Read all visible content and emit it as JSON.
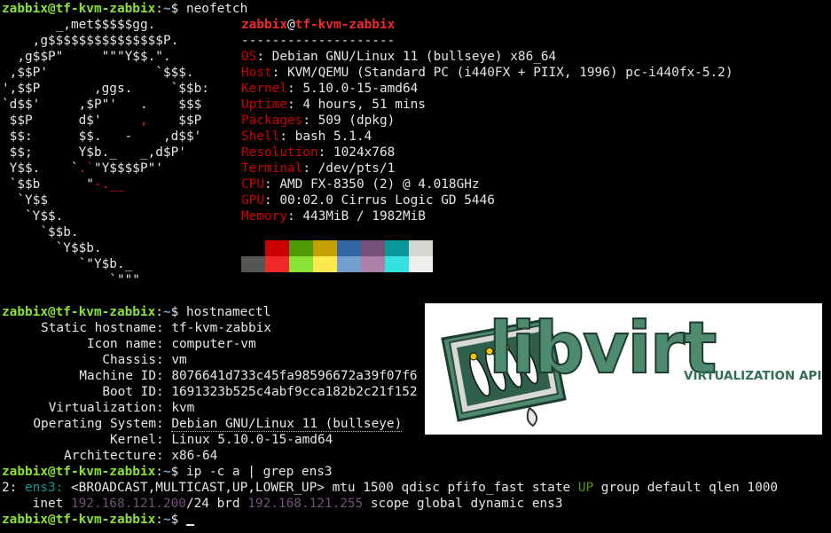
{
  "prompt": {
    "user_host": "zabbix@tf-kvm-zabbix",
    "sep": ":",
    "path": "~",
    "dollar": "$ "
  },
  "commands": {
    "neofetch": "neofetch",
    "hostnamectl": "hostnamectl",
    "ip": "ip -c a | grep ens3",
    "current": ""
  },
  "debian_logo_lines": [
    "       _,met$$$$$gg.",
    "    ,g$$$$$$$$$$$$$$$P.",
    "  ,g$$P\"     \"\"\"Y$$.\".",
    " ,$$P'              `$$$.",
    "',$$P       ,ggs.     `$$b:",
    "`d$$'     ,$P\"'   .    $$$",
    " $$P      d$'     ,    $$P",
    " $$:      $$.   -    ,d$$'",
    " $$;      Y$b._   _,d$P'",
    " Y$$.    `.`\"Y$$$$P\"'",
    " `$$b      \"-.__",
    "  `Y$$",
    "   `Y$$.",
    "     `$$b.",
    "       `Y$$b.",
    "          `\"Y$b._",
    "              `\"\"\""
  ],
  "neofetch": {
    "user": "zabbix",
    "at": "@",
    "host": "tf-kvm-zabbix",
    "divider": "--------------------",
    "rows": [
      {
        "key": "OS",
        "value": "Debian GNU/Linux 11 (bullseye) x86_64"
      },
      {
        "key": "Host",
        "value": "KVM/QEMU (Standard PC (i440FX + PIIX, 1996) pc-i440fx-5.2)"
      },
      {
        "key": "Kernel",
        "value": "5.10.0-15-amd64"
      },
      {
        "key": "Uptime",
        "value": "4 hours, 51 mins"
      },
      {
        "key": "Packages",
        "value": "509 (dpkg)"
      },
      {
        "key": "Shell",
        "value": "bash 5.1.4"
      },
      {
        "key": "Resolution",
        "value": "1024x768"
      },
      {
        "key": "Terminal",
        "value": "/dev/pts/1"
      },
      {
        "key": "CPU",
        "value": "AMD FX-8350 (2) @ 4.018GHz"
      },
      {
        "key": "GPU",
        "value": "00:02.0 Cirrus Logic GD 5446"
      },
      {
        "key": "Memory",
        "value": "443MiB / 1982MiB"
      }
    ],
    "palette_top": [
      "#000000",
      "#cc0000",
      "#4e9a06",
      "#c4a000",
      "#3465a4",
      "#75507b",
      "#06989a",
      "#d3d7cf"
    ],
    "palette_bottom": [
      "#555753",
      "#ef2929",
      "#8ae234",
      "#fce94f",
      "#729fcf",
      "#ad7fa8",
      "#34e2e2",
      "#eeeeec"
    ]
  },
  "hostnamectl": [
    {
      "key": "Static hostname",
      "value": "tf-kvm-zabbix"
    },
    {
      "key": "Icon name",
      "value": "computer-vm"
    },
    {
      "key": "Chassis",
      "value": "vm"
    },
    {
      "key": "Machine ID",
      "value": "8076641d733c45fa98596672a39f07f6"
    },
    {
      "key": "Boot ID",
      "value": "1691323b525c4abf9cca182b2c21f152"
    },
    {
      "key": "Virtualization",
      "value": "kvm"
    },
    {
      "key": "Operating System",
      "value": "Debian GNU/Linux 11 (bullseye)"
    },
    {
      "key": "Kernel",
      "value": "Linux 5.10.0-15-amd64"
    },
    {
      "key": "Architecture",
      "value": "x86-64"
    }
  ],
  "ip_output": {
    "idx": "2: ",
    "iface": "ens3:",
    "flags": " <BROADCAST,MULTICAST,UP,LOWER_UP> mtu 1500 qdisc pfifo_fast state ",
    "state": "UP",
    "rest": " group default qlen 1000",
    "inet_label": "    inet ",
    "inet_addr": "192.168.121.200",
    "prefix": "/24 brd ",
    "brd_addr": "192.168.121.255",
    "scope": " scope global dynamic ens3"
  },
  "libvirt": {
    "wordmark": "libvirt",
    "tagline": "VIRTUALIZATION API"
  }
}
